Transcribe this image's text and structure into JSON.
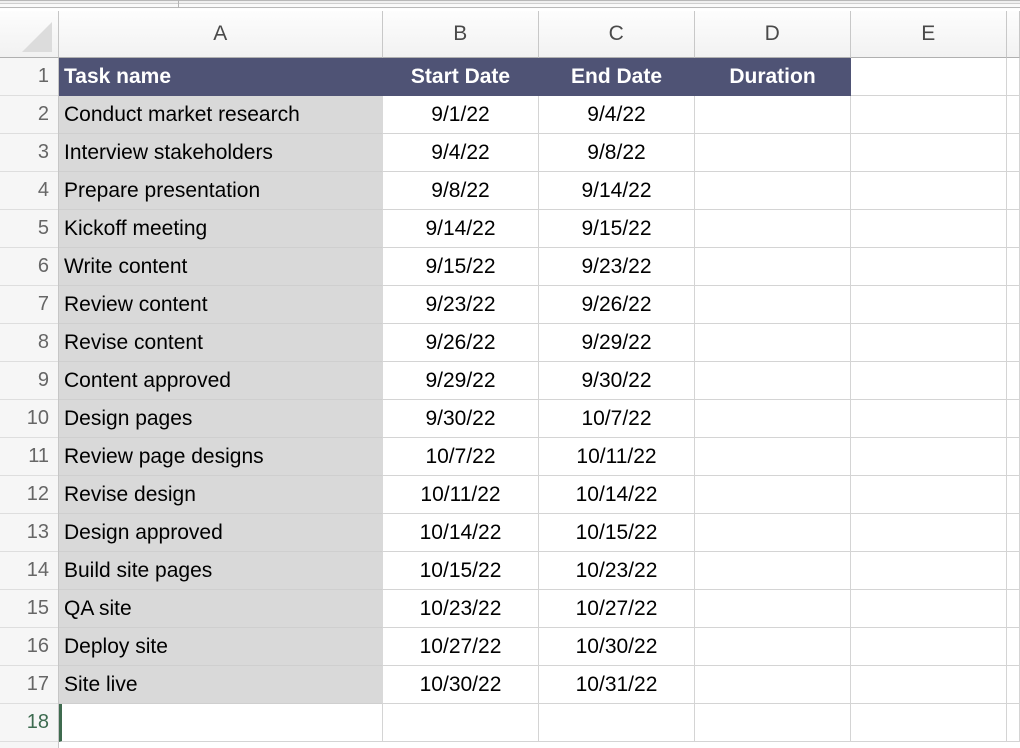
{
  "app": {
    "type": "spreadsheet",
    "column_headers": [
      "A",
      "B",
      "C",
      "D",
      "E"
    ],
    "row_headers": [
      "1",
      "2",
      "3",
      "4",
      "5",
      "6",
      "7",
      "8",
      "9",
      "10",
      "11",
      "12",
      "13",
      "14",
      "15",
      "16",
      "17",
      "18"
    ],
    "active_row": "18",
    "active_cell": "A18",
    "select_all_icon": "select-all-triangle-icon"
  },
  "colors": {
    "header_fill": "#4f5375",
    "header_text": "#ffffff",
    "task_column_fill": "#d9d9d9",
    "gridline": "#d4d4d4",
    "row_header_fill": "#f6f6f6",
    "selection_green": "#3d6b50",
    "cell_text": "#000000"
  },
  "table": {
    "headers": [
      "Task name",
      "Start Date",
      "End Date",
      "Duration"
    ],
    "rows": [
      {
        "task": "Conduct market research",
        "start": "9/1/22",
        "end": "9/4/22",
        "duration": ""
      },
      {
        "task": "Interview stakeholders",
        "start": "9/4/22",
        "end": "9/8/22",
        "duration": ""
      },
      {
        "task": "Prepare presentation",
        "start": "9/8/22",
        "end": "9/14/22",
        "duration": ""
      },
      {
        "task": "Kickoff meeting",
        "start": "9/14/22",
        "end": "9/15/22",
        "duration": ""
      },
      {
        "task": "Write content",
        "start": "9/15/22",
        "end": "9/23/22",
        "duration": ""
      },
      {
        "task": "Review content",
        "start": "9/23/22",
        "end": "9/26/22",
        "duration": ""
      },
      {
        "task": "Revise content",
        "start": "9/26/22",
        "end": "9/29/22",
        "duration": ""
      },
      {
        "task": "Content approved",
        "start": "9/29/22",
        "end": "9/30/22",
        "duration": ""
      },
      {
        "task": "Design pages",
        "start": "9/30/22",
        "end": "10/7/22",
        "duration": ""
      },
      {
        "task": "Review page designs",
        "start": "10/7/22",
        "end": "10/11/22",
        "duration": ""
      },
      {
        "task": "Revise design",
        "start": "10/11/22",
        "end": "10/14/22",
        "duration": ""
      },
      {
        "task": "Design approved",
        "start": "10/14/22",
        "end": "10/15/22",
        "duration": ""
      },
      {
        "task": "Build site pages",
        "start": "10/15/22",
        "end": "10/23/22",
        "duration": ""
      },
      {
        "task": "QA site",
        "start": "10/23/22",
        "end": "10/27/22",
        "duration": ""
      },
      {
        "task": "Deploy site",
        "start": "10/27/22",
        "end": "10/30/22",
        "duration": ""
      },
      {
        "task": "Site live",
        "start": "10/30/22",
        "end": "10/31/22",
        "duration": ""
      }
    ]
  }
}
